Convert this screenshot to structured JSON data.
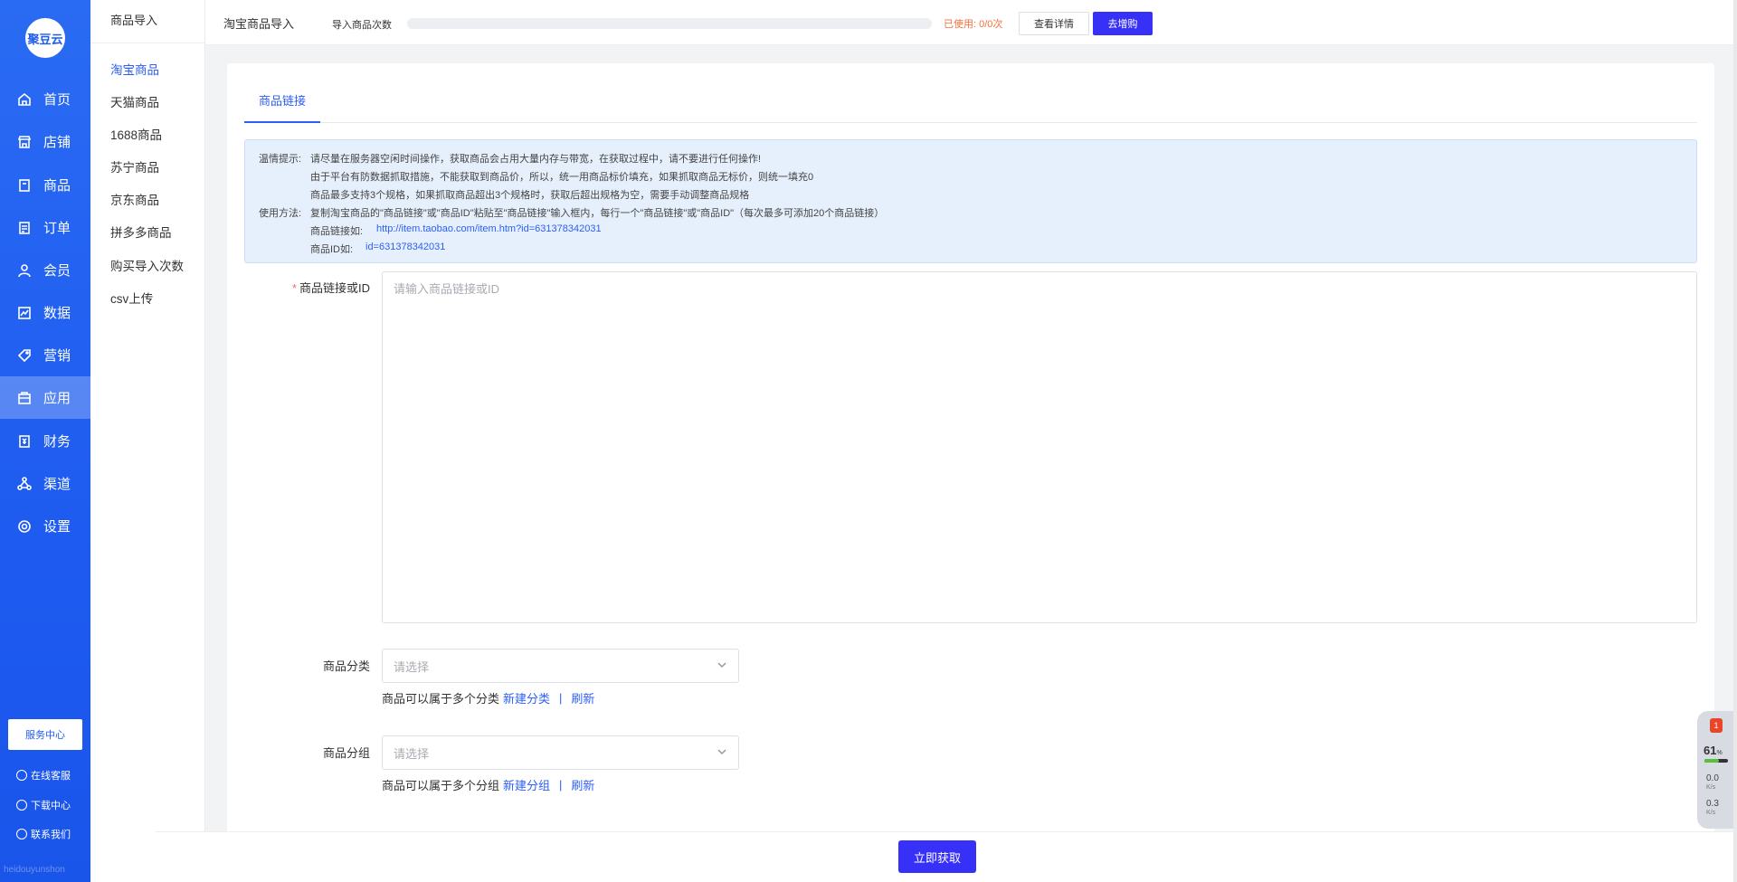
{
  "brand": {
    "logo_text": "聚豆云",
    "watermark": "heidouyunshon"
  },
  "sidebar": {
    "items": [
      {
        "label": "首页",
        "icon": "home-icon"
      },
      {
        "label": "店铺",
        "icon": "store-icon"
      },
      {
        "label": "商品",
        "icon": "goods-icon"
      },
      {
        "label": "订单",
        "icon": "order-icon"
      },
      {
        "label": "会员",
        "icon": "member-icon"
      },
      {
        "label": "数据",
        "icon": "chart-icon"
      },
      {
        "label": "营销",
        "icon": "tag-icon"
      },
      {
        "label": "应用",
        "icon": "app-icon",
        "active": true
      },
      {
        "label": "财务",
        "icon": "finance-icon"
      },
      {
        "label": "渠道",
        "icon": "channel-icon"
      },
      {
        "label": "设置",
        "icon": "gear-icon"
      }
    ],
    "service_center": "服务中心",
    "online_service": "在线客服",
    "download_center": "下载中心",
    "contact_us": "联系我们"
  },
  "subnav": {
    "title": "商品导入",
    "items": [
      "淘宝商品",
      "天猫商品",
      "1688商品",
      "苏宁商品",
      "京东商品",
      "拼多多商品",
      "购买导入次数",
      "csv上传"
    ],
    "active_index": 0
  },
  "topbar": {
    "title": "淘宝商品导入",
    "count_label": "导入商品次数",
    "usage_progress": 0.0,
    "used_text": "已使用: 0/0次",
    "detail_button": "查看详情",
    "buy_button": "去增购"
  },
  "tabs": [
    "商品链接"
  ],
  "tips": {
    "tip_prefix": "温情提示:",
    "line1": "请尽量在服务器空闲时间操作，获取商品会占用大量内存与带宽，在获取过程中，请不要进行任何操作!",
    "line2": "由于平台有防数据抓取措施，不能获取到商品价，所以，统一用商品标价填充，如果抓取商品无标价，则统一填充0",
    "line3": "商品最多支持3个规格，如果抓取商品超出3个规格时，获取后超出规格为空，需要手动调整商品规格",
    "usage_prefix": "使用方法:",
    "line4": "复制淘宝商品的\"商品链接\"或\"商品ID\"粘贴至\"商品链接\"输入框内，每行一个\"商品链接\"或\"商品ID\"（每次最多可添加20个商品链接）",
    "link_example_label": "商品链接如:",
    "link_example": "http://item.taobao.com/item.htm?id=631378342031",
    "id_example_label": "商品ID如:",
    "id_example": "id=631378342031"
  },
  "form": {
    "link_label": "商品链接或ID",
    "link_placeholder": "请输入商品链接或ID",
    "category_label": "商品分类",
    "category_placeholder": "请选择",
    "category_help": "商品可以属于多个分类",
    "category_new": "新建分类",
    "refresh": "刷新",
    "group_label": "商品分组",
    "group_placeholder": "请选择",
    "group_help": "商品可以属于多个分组",
    "group_new": "新建分组"
  },
  "submit_button": "立即获取",
  "widget": {
    "badge": "1",
    "percent": "61",
    "percent_unit": "%",
    "up": "0.0",
    "down": "0.3",
    "unit": "K/s"
  }
}
